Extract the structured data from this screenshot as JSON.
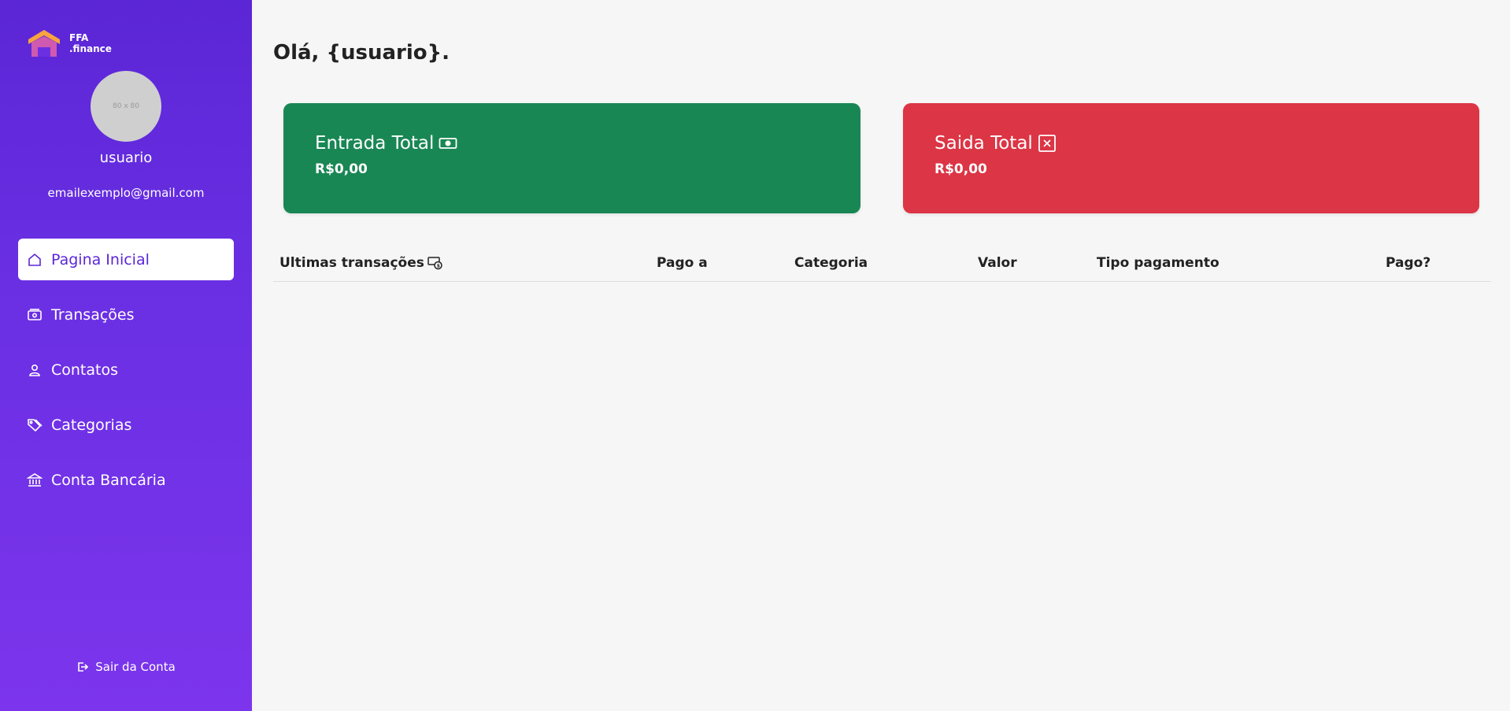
{
  "brand": {
    "line1": "FFA",
    "line2": ".finance"
  },
  "user": {
    "avatar_placeholder": "80 x 80",
    "name": "usuario",
    "email": "emailexemplo@gmail.com"
  },
  "nav": {
    "items": [
      {
        "label": "Pagina Inicial",
        "icon": "home-icon",
        "active": true
      },
      {
        "label": "Transações",
        "icon": "money-icon",
        "active": false
      },
      {
        "label": "Contatos",
        "icon": "person-icon",
        "active": false
      },
      {
        "label": "Categorias",
        "icon": "tags-icon",
        "active": false
      },
      {
        "label": "Conta Bancária",
        "icon": "bank-icon",
        "active": false
      }
    ]
  },
  "logout": {
    "label": "Sair da Conta",
    "icon": "box-arrow-right-icon"
  },
  "greeting": "Olá, {usuario}.",
  "cards": {
    "income": {
      "title": "Entrada Total",
      "value": "R$0,00",
      "icon": "cash-icon",
      "color": "#198754"
    },
    "expense": {
      "title": "Saida Total",
      "value": "R$0,00",
      "icon": "x-square-icon",
      "color": "#dc3545"
    }
  },
  "table": {
    "headers": [
      "Ultimas transações",
      "Pago a",
      "Categoria",
      "Valor",
      "Tipo pagamento",
      "Pago?"
    ],
    "rows": []
  },
  "colors": {
    "sidebar_top": "#5b26d6",
    "sidebar_bottom": "#7c35ec",
    "background": "#f6f6f6"
  }
}
